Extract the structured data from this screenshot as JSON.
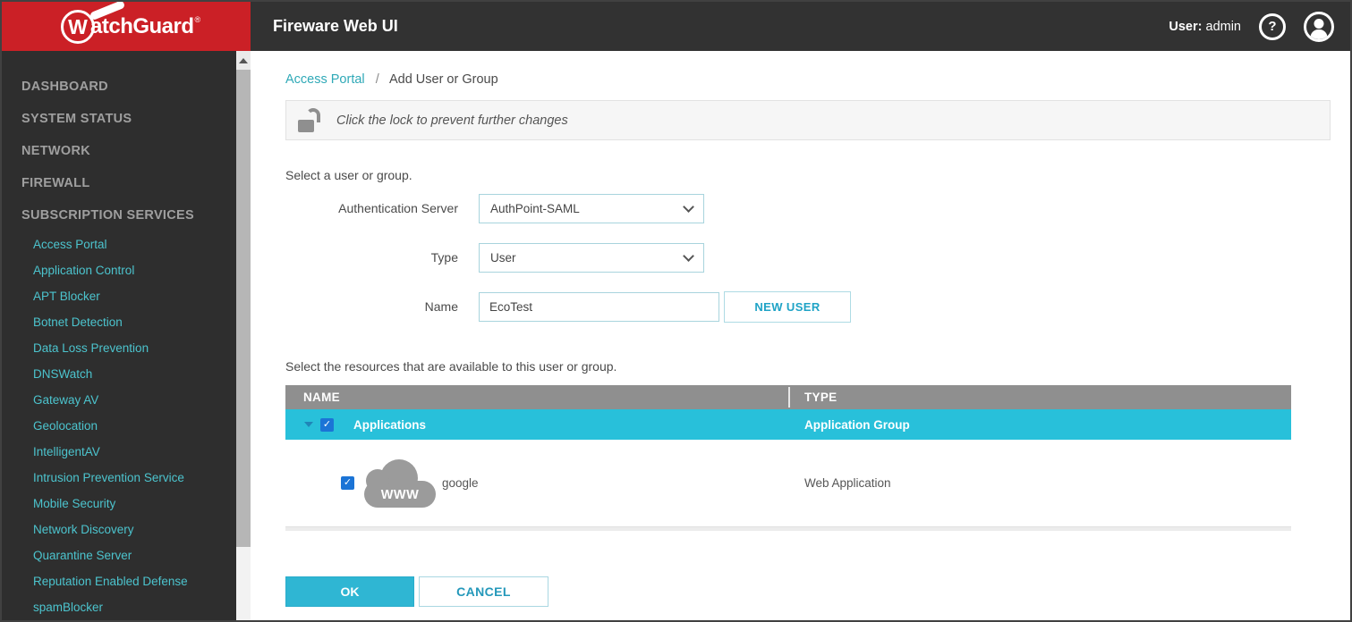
{
  "header": {
    "brand_w": "W",
    "brand_rest": "atchGuard",
    "brand_reg": "®",
    "app_title": "Fireware Web UI",
    "user_label": "User:",
    "user_name": "admin",
    "help_glyph": "?"
  },
  "sidebar": {
    "top_items": [
      "DASHBOARD",
      "SYSTEM STATUS",
      "NETWORK",
      "FIREWALL",
      "SUBSCRIPTION SERVICES"
    ],
    "sub_items": [
      "Access Portal",
      "Application Control",
      "APT Blocker",
      "Botnet Detection",
      "Data Loss Prevention",
      "DNSWatch",
      "Gateway AV",
      "Geolocation",
      "IntelligentAV",
      "Intrusion Prevention Service",
      "Mobile Security",
      "Network Discovery",
      "Quarantine Server",
      "Reputation Enabled Defense",
      "spamBlocker"
    ]
  },
  "breadcrumb": {
    "parent": "Access Portal",
    "separator": "/",
    "current": "Add User or Group"
  },
  "lock_notice": "Click the lock to prevent further changes",
  "form": {
    "section_label": "Select a user or group.",
    "auth_server_label": "Authentication Server",
    "auth_server_value": "AuthPoint-SAML",
    "type_label": "Type",
    "type_value": "User",
    "name_label": "Name",
    "name_value": "EcoTest",
    "new_user_button": "NEW USER"
  },
  "resources": {
    "section_label": "Select the resources that are available to this user or group.",
    "columns": [
      "NAME",
      "TYPE"
    ],
    "rows": [
      {
        "name": "Applications",
        "type": "Application Group",
        "checked": true,
        "selected": true,
        "expandable": true
      },
      {
        "name": "google",
        "type": "Web Application",
        "checked": true,
        "icon": "www-cloud-icon",
        "icon_text": "WWW"
      }
    ]
  },
  "actions": {
    "ok": "OK",
    "cancel": "CANCEL"
  },
  "colors": {
    "brand_red": "#cb2026",
    "header_dark": "#323232",
    "sidebar_dark": "#2e2e2e",
    "accent_teal": "#2fb6d3",
    "row_highlight": "#28c0da",
    "table_header_gray": "#8f8f8f",
    "checkbox_blue": "#1b74d6",
    "sub_item_teal": "#4cc4ce"
  }
}
